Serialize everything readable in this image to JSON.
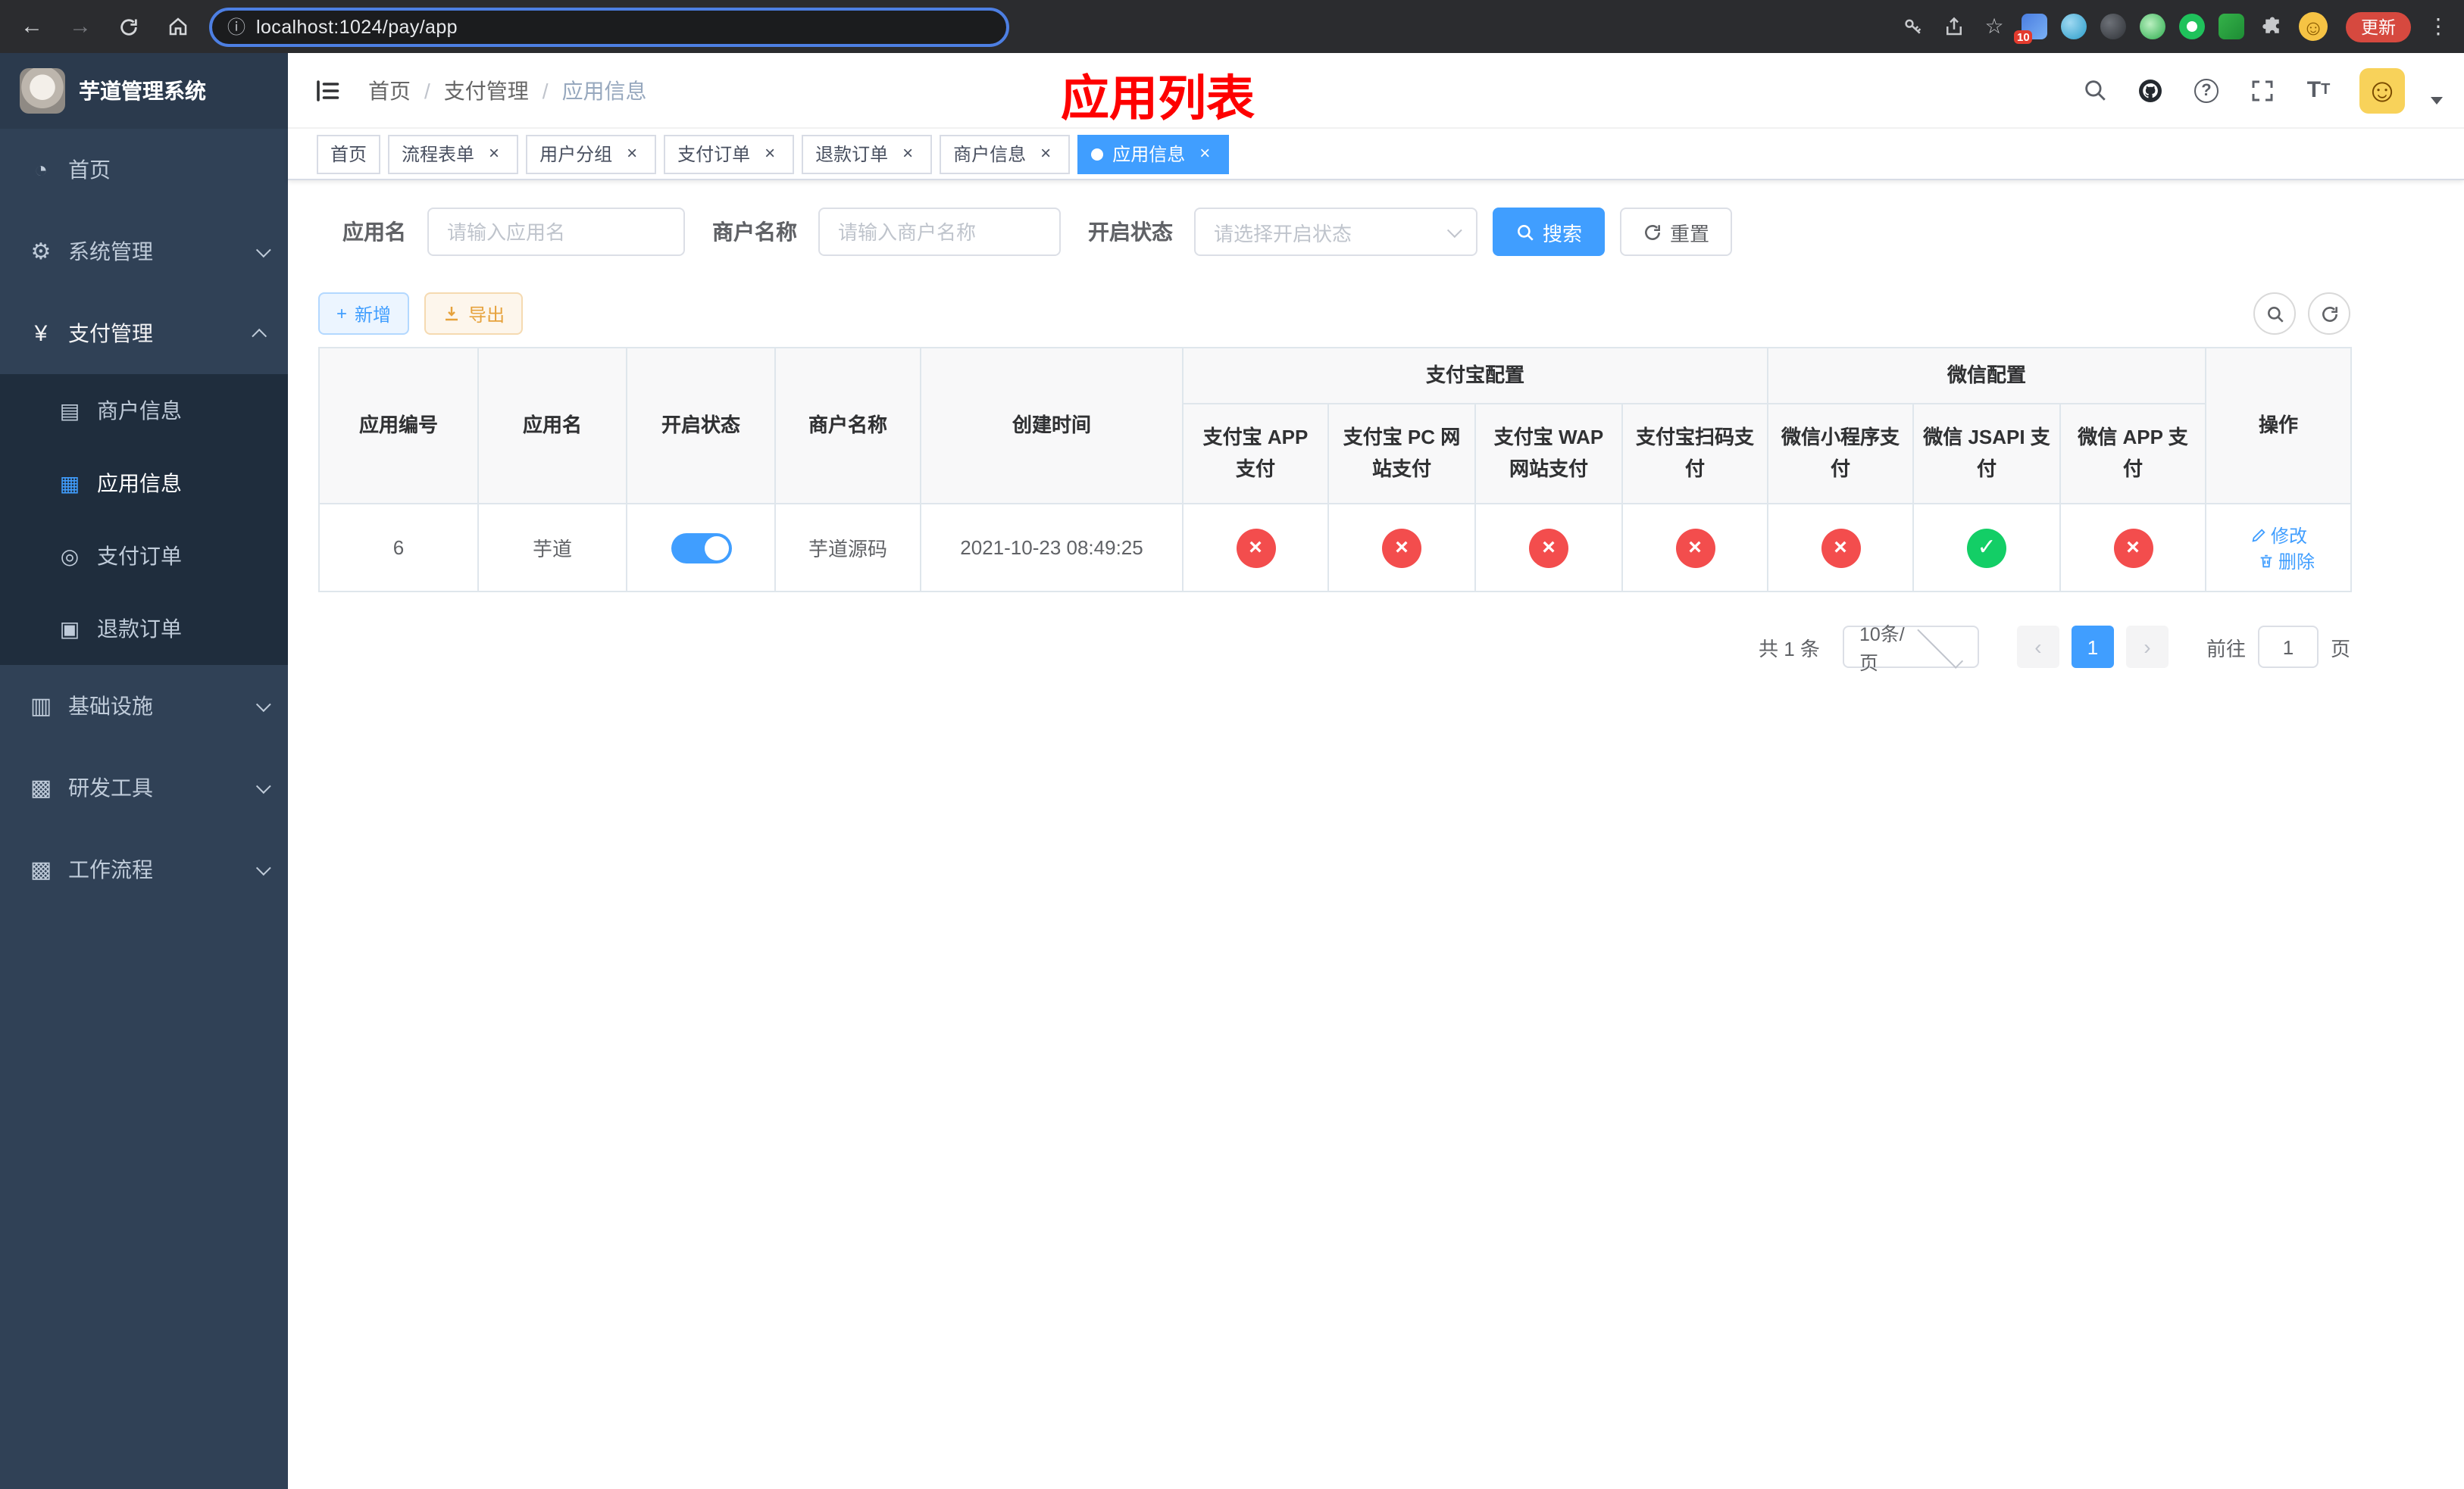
{
  "browser": {
    "url": "localhost:1024/pay/app",
    "update_button": "更新",
    "extension_badge": "10"
  },
  "sidebar": {
    "app_title": "芋道管理系统",
    "menu": [
      {
        "label": "首页"
      },
      {
        "label": "系统管理",
        "expandable": true
      },
      {
        "label": "支付管理",
        "expandable": true,
        "expanded": true,
        "children": [
          {
            "label": "商户信息"
          },
          {
            "label": "应用信息",
            "active": true
          },
          {
            "label": "支付订单"
          },
          {
            "label": "退款订单"
          }
        ]
      },
      {
        "label": "基础设施",
        "expandable": true
      },
      {
        "label": "研发工具",
        "expandable": true
      },
      {
        "label": "工作流程",
        "expandable": true
      }
    ]
  },
  "header": {
    "breadcrumb": [
      "首页",
      "支付管理",
      "应用信息"
    ],
    "page_title": "应用列表"
  },
  "tabs": [
    {
      "label": "首页",
      "closable": false
    },
    {
      "label": "流程表单",
      "closable": true
    },
    {
      "label": "用户分组",
      "closable": true
    },
    {
      "label": "支付订单",
      "closable": true
    },
    {
      "label": "退款订单",
      "closable": true
    },
    {
      "label": "商户信息",
      "closable": true
    },
    {
      "label": "应用信息",
      "closable": true,
      "active": true
    }
  ],
  "filters": {
    "app_name_label": "应用名",
    "app_name_placeholder": "请输入应用名",
    "merchant_label": "商户名称",
    "merchant_placeholder": "请输入商户名称",
    "status_label": "开启状态",
    "status_placeholder": "请选择开启状态",
    "search_button": "搜索",
    "reset_button": "重置"
  },
  "toolbar": {
    "add_button": "新增",
    "export_button": "导出"
  },
  "table": {
    "columns": [
      "应用编号",
      "应用名",
      "开启状态",
      "商户名称",
      "创建时间"
    ],
    "alipay_group": "支付宝配置",
    "wechat_group": "微信配置",
    "alipay_columns": [
      "支付宝 APP 支付",
      "支付宝 PC 网站支付",
      "支付宝 WAP 网站支付",
      "支付宝扫码支付"
    ],
    "wechat_columns": [
      "微信小程序支付",
      "微信 JSAPI 支付",
      "微信 APP 支付"
    ],
    "actions_column": "操作",
    "rows": [
      {
        "id": "6",
        "name": "芋道",
        "enabled": true,
        "merchant": "芋道源码",
        "created": "2021-10-23 08:49:25",
        "configs": [
          "no",
          "no",
          "no",
          "no",
          "no",
          "yes",
          "no"
        ],
        "edit_label": "修改",
        "delete_label": "删除"
      }
    ]
  },
  "pagination": {
    "total_text": "共 1 条",
    "page_size": "10条/页",
    "current_page": "1",
    "goto_label": "前往",
    "goto_value": "1",
    "goto_unit": "页"
  },
  "colors": {
    "primary": "#409eff",
    "success_green": "#13ce66",
    "danger_red": "#f34d4d",
    "title_red": "#fe0000"
  }
}
